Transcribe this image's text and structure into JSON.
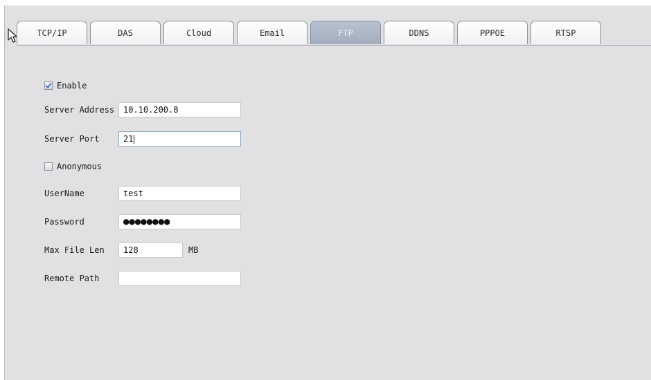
{
  "tabs": [
    {
      "label": "TCP/IP",
      "active": false
    },
    {
      "label": "DAS",
      "active": false
    },
    {
      "label": "Cloud",
      "active": false
    },
    {
      "label": "Email",
      "active": false
    },
    {
      "label": "FTP",
      "active": true
    },
    {
      "label": "DDNS",
      "active": false
    },
    {
      "label": "PPPOE",
      "active": false
    },
    {
      "label": "RTSP",
      "active": false
    }
  ],
  "form": {
    "enable": {
      "label": "Enable",
      "checked": true
    },
    "server_address": {
      "label": "Server Address",
      "value": "10.10.200.8"
    },
    "server_port": {
      "label": "Server Port",
      "value": "21"
    },
    "anonymous": {
      "label": "Anonymous",
      "checked": false
    },
    "username": {
      "label": "UserName",
      "value": "test"
    },
    "password": {
      "label": "Password",
      "masked": "●●●●●●●●"
    },
    "max_file_len": {
      "label": "Max File Len",
      "value": "128",
      "unit": "MB"
    },
    "remote_path": {
      "label": "Remote Path",
      "value": ""
    }
  },
  "colors": {
    "panel_bg": "#e1e1e3",
    "active_tab": "#a3adbd",
    "check_mark": "#3a6cc8"
  },
  "icons": {
    "cursor": "mouse-pointer-icon",
    "check": "checkmark-icon"
  }
}
